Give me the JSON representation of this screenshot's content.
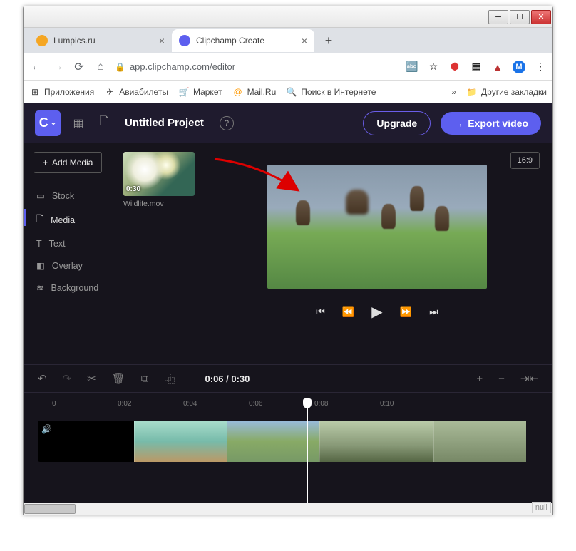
{
  "tabs": [
    {
      "title": "Lumpics.ru",
      "favcolor": "#f5a623"
    },
    {
      "title": "Clipchamp Create",
      "favcolor": "#5d5fef"
    }
  ],
  "url": "app.clipchamp.com/editor",
  "bookmarks": {
    "apps": "Приложения",
    "avia": "Авиабилеты",
    "market": "Маркет",
    "mailru": "Mail.Ru",
    "search": "Поиск в Интернете",
    "other": "Другие закладки"
  },
  "toolbar": {
    "logo": "C",
    "project": "Untitled Project",
    "upgrade": "Upgrade",
    "export": "Export video"
  },
  "sidebar": {
    "add": "Add Media",
    "items": [
      "Stock",
      "Media",
      "Text",
      "Overlay",
      "Background"
    ]
  },
  "media": {
    "duration": "0:30",
    "name": "Wildlife.mov"
  },
  "preview": {
    "aspect": "16:9"
  },
  "timeline": {
    "time": "0:06 / 0:30",
    "marks": [
      "0",
      "0:02",
      "0:04",
      "0:06",
      "0:08",
      "0:10"
    ]
  },
  "null_label": "null"
}
